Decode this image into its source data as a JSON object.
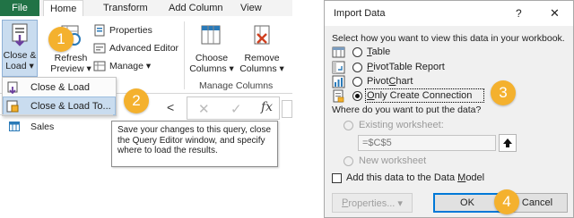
{
  "ribbon": {
    "file_tab": "File",
    "tabs": [
      "Home",
      "Transform",
      "Add Column",
      "View"
    ],
    "close_load": {
      "line1": "Close &",
      "line2": "Load ▾"
    },
    "refresh_preview": {
      "line1": "Refresh",
      "line2": "Preview ▾"
    },
    "properties": "Properties",
    "advanced_editor": "Advanced Editor",
    "manage": "Manage ▾",
    "choose_columns": {
      "line1": "Choose",
      "line2": "Columns ▾"
    },
    "remove_columns": {
      "line1": "Remove",
      "line2": "Columns ▾"
    },
    "group_manage_columns": "Manage Columns"
  },
  "menu": {
    "items": [
      "Close & Load",
      "Close & Load To..."
    ]
  },
  "queries": {
    "items": [
      "Sales"
    ],
    "collapse_glyph": "<"
  },
  "formula_bar": {
    "cancel_glyph": "✕",
    "confirm_glyph": "✓",
    "fx_label": "fx"
  },
  "tooltip": {
    "text": "Save your changes to this query, close the Query Editor window, and specify where to load the results."
  },
  "callouts": [
    "1",
    "2",
    "3",
    "4"
  ],
  "dialog": {
    "title": "Import Data",
    "help": "?",
    "close": "✕",
    "view_prompt": "Select how you want to view this data in your workbook.",
    "view_options": [
      {
        "pre": "",
        "key": "T",
        "post": "able",
        "checked": false
      },
      {
        "pre": "",
        "key": "P",
        "post": "ivotTable Report",
        "checked": false
      },
      {
        "pre": "Pivot",
        "key": "C",
        "post": "hart",
        "checked": false
      },
      {
        "pre": "",
        "key": "O",
        "post": "nly Create Connection",
        "checked": true
      }
    ],
    "put_prompt": "Where do you want to put the data?",
    "existing_worksheet": "Existing worksheet:",
    "range_value": "=$C$5",
    "new_worksheet": "New worksheet",
    "data_model": {
      "pre": "Add this data to the Data ",
      "key": "M",
      "post": "odel"
    },
    "properties_button": {
      "pre": "",
      "key": "P",
      "post": "roperties... ▾"
    },
    "ok_button": "OK",
    "cancel_button": "Cancel"
  },
  "colors": {
    "excel_green": "#217346",
    "callout_orange": "#f4b12e",
    "selection_blue": "#c9dcef",
    "dialog_bg": "#f0f0f0"
  }
}
